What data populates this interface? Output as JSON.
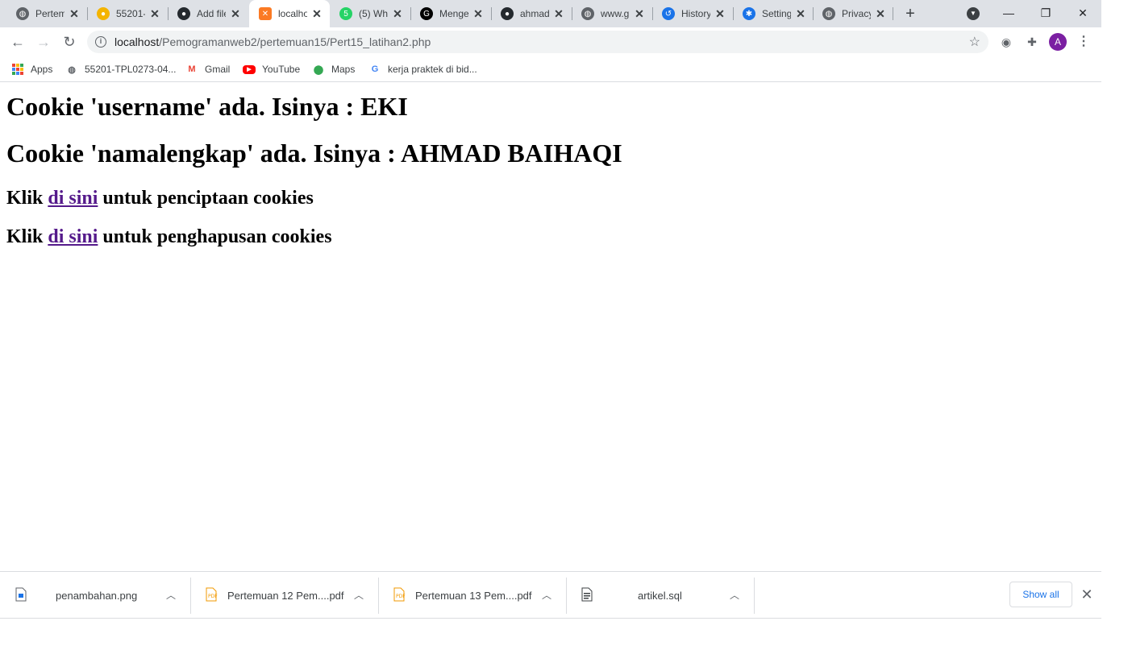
{
  "window": {
    "minimize_glyph": "—",
    "restore_glyph": "❐",
    "close_glyph": "✕"
  },
  "tabs": [
    {
      "title": "Pertemuan",
      "icon": "globe-icon",
      "color": "#5f6368",
      "active": false
    },
    {
      "title": "55201-",
      "icon": "cookie-icon",
      "color": "#f4b400",
      "active": false
    },
    {
      "title": "Add files",
      "icon": "github-icon",
      "color": "#24292e",
      "active": false
    },
    {
      "title": "localhost",
      "icon": "xampp-icon",
      "color": "#fb7a24",
      "active": true
    },
    {
      "title": "(5) Wh",
      "icon": "whatsapp-icon",
      "color": "#25d366",
      "active": false
    },
    {
      "title": "Menge",
      "icon": "g-icon",
      "color": "#000000",
      "active": false
    },
    {
      "title": "ahmad",
      "icon": "github-icon",
      "color": "#24292e",
      "active": false
    },
    {
      "title": "www.g",
      "icon": "globe-icon",
      "color": "#5f6368",
      "active": false
    },
    {
      "title": "History",
      "icon": "history-icon",
      "color": "#1a73e8",
      "active": false
    },
    {
      "title": "Settings",
      "icon": "gear-icon",
      "color": "#1a73e8",
      "active": false
    },
    {
      "title": "Privacy",
      "icon": "globe-icon",
      "color": "#5f6368",
      "active": false
    }
  ],
  "toolbar": {
    "url_host": "localhost",
    "url_path": "/Pemogramanweb2/pertemuan15/Pert15_latihan2.php"
  },
  "bookmarks": [
    {
      "label": "Apps",
      "icon": "apps-grid-icon"
    },
    {
      "label": "55201-TPL0273-04...",
      "icon": "globe-icon"
    },
    {
      "label": "Gmail",
      "icon": "gmail-icon"
    },
    {
      "label": "YouTube",
      "icon": "youtube-icon"
    },
    {
      "label": "Maps",
      "icon": "maps-icon"
    },
    {
      "label": "kerja praktek di bid...",
      "icon": "google-icon"
    }
  ],
  "page": {
    "line1": "Cookie 'username' ada. Isinya : EKI",
    "line2": "Cookie 'namalengkap' ada. Isinya : AHMAD BAIHAQI",
    "create": {
      "prefix": "Klik ",
      "link": "di sini",
      "suffix": " untuk penciptaan cookies"
    },
    "delete": {
      "prefix": "Klik ",
      "link": "di sini",
      "suffix": " untuk penghapusan cookies"
    }
  },
  "downloads": [
    {
      "name": "penambahan.png",
      "icon": "image-file-icon"
    },
    {
      "name": "Pertemuan 12 Pem....pdf",
      "icon": "pdf-file-icon"
    },
    {
      "name": "Pertemuan 13 Pem....pdf",
      "icon": "pdf-file-icon"
    },
    {
      "name": "artikel.sql",
      "icon": "sql-file-icon"
    }
  ],
  "shelf": {
    "show_all": "Show all"
  }
}
